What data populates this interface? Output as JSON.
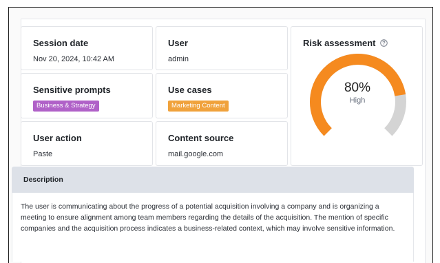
{
  "session": {
    "title": "Session date",
    "value": "Nov 20, 2024, 10:42 AM"
  },
  "user": {
    "title": "User",
    "value": "admin"
  },
  "sensitive_prompts": {
    "title": "Sensitive prompts",
    "badge": "Business & Strategy",
    "badge_color": "#b061c8"
  },
  "use_cases": {
    "title": "Use cases",
    "badge": "Marketing Content",
    "badge_color": "#f0a23c"
  },
  "user_action": {
    "title": "User action",
    "value": "Paste"
  },
  "content_source": {
    "title": "Content source",
    "value": "mail.google.com"
  },
  "risk": {
    "title": "Risk assessment",
    "icon": "help-circle-icon",
    "percent_label": "80%",
    "value": 0.8,
    "level": "High",
    "fill_color": "#f58a1f",
    "track_color": "#d4d4d4"
  },
  "description": {
    "title": "Description",
    "text": "The user is communicating about the progress of a potential acquisition involving a company and is organizing a meeting to ensure alignment among team members regarding the details of the acquisition. The mention of specific companies and the acquisition process indicates a business-related context, which may involve sensitive information."
  }
}
